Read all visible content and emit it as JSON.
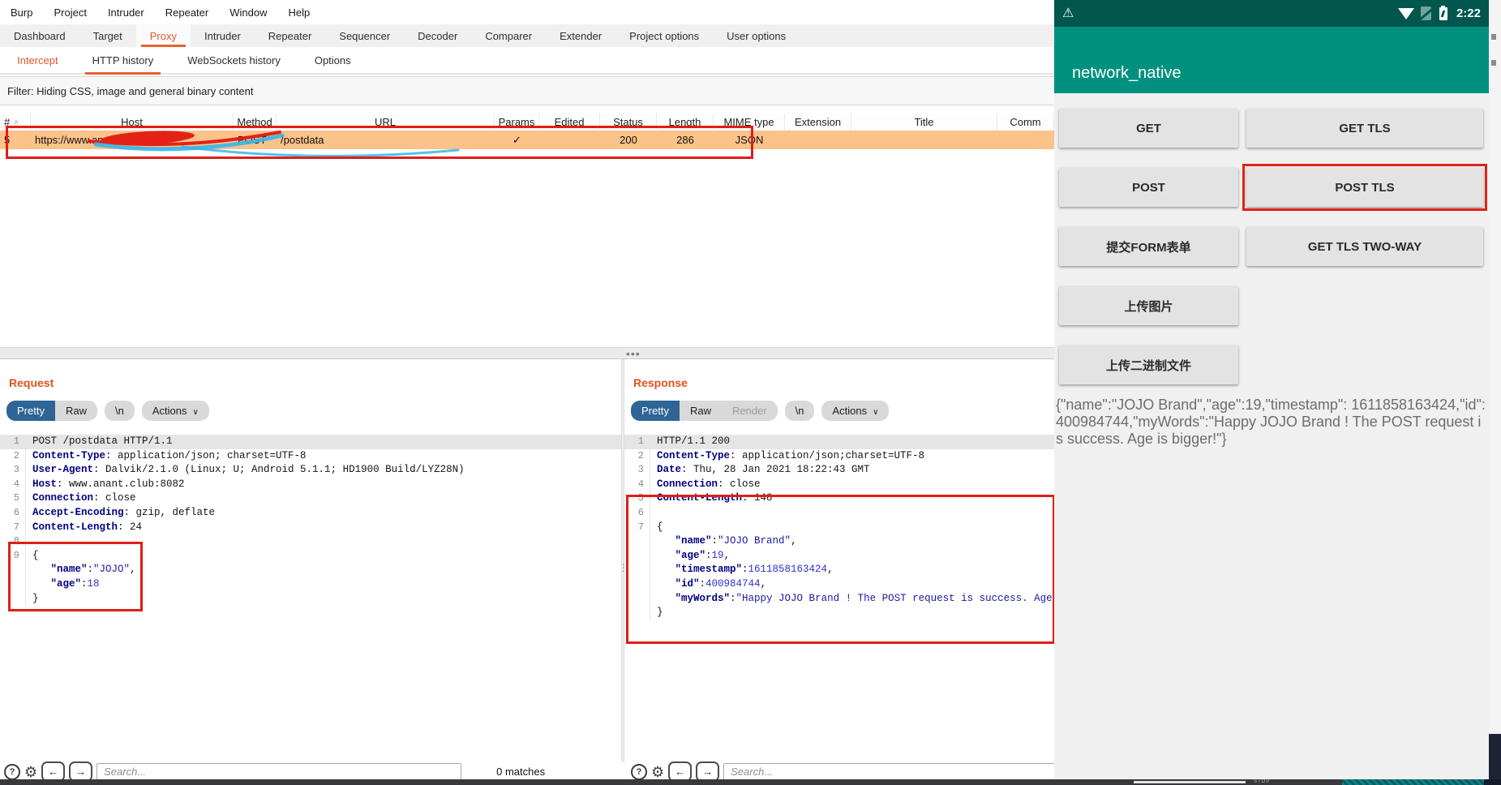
{
  "colors": {
    "accent_orange": "#e05a24",
    "selected_tab_blue": "#2e6496",
    "annotation_red": "#df1f16",
    "row_highlight_orange": "#fbc28a",
    "android_teal": "#00917e",
    "android_teal_dark": "#01564d"
  },
  "burp": {
    "menu": [
      "Burp",
      "Project",
      "Intruder",
      "Repeater",
      "Window",
      "Help"
    ],
    "main_tabs": {
      "items": [
        "Dashboard",
        "Target",
        "Proxy",
        "Intruder",
        "Repeater",
        "Sequencer",
        "Decoder",
        "Comparer",
        "Extender",
        "Project options",
        "User options"
      ],
      "selected": "Proxy"
    },
    "sub_tabs": {
      "items": [
        "Intercept",
        "HTTP history",
        "WebSockets history",
        "Options"
      ],
      "selected": "HTTP history",
      "accent": "Intercept"
    },
    "filter_text": "Filter: Hiding CSS, image and general binary content",
    "history_table": {
      "columns": [
        "#",
        "Host",
        "Method",
        "URL",
        "Params",
        "Edited",
        "Status",
        "Length",
        "MIME type",
        "Extension",
        "Title",
        "Comm"
      ],
      "row": [
        "5",
        "https://www.anant.club:8082",
        "POST",
        "/postdata",
        "✓",
        "",
        "200",
        "286",
        "JSON",
        "",
        "",
        ""
      ]
    },
    "request_panel": {
      "title": "Request",
      "tabs": [
        {
          "label": "Pretty",
          "selected": true
        },
        {
          "label": "Raw"
        }
      ],
      "newline_label": "\\n",
      "actions_label": "Actions",
      "lines": [
        {
          "n": "1",
          "hl": true,
          "seg": [
            [
              "POST /postdata HTTP/1.1",
              "p"
            ]
          ]
        },
        {
          "n": "2",
          "seg": [
            [
              "Content-Type",
              "h"
            ],
            [
              ": application/json; charset=UTF-8",
              "p"
            ]
          ]
        },
        {
          "n": "3",
          "seg": [
            [
              "User-Agent",
              "h"
            ],
            [
              ": Dalvik/2.1.0 (Linux; U; Android 5.1.1; HD1900 Build/LYZ28N)",
              "p"
            ]
          ]
        },
        {
          "n": "4",
          "seg": [
            [
              "Host",
              "h"
            ],
            [
              ": www.anant.club:8082",
              "p"
            ]
          ]
        },
        {
          "n": "5",
          "seg": [
            [
              "Connection",
              "h"
            ],
            [
              ": close",
              "p"
            ]
          ]
        },
        {
          "n": "6",
          "seg": [
            [
              "Accept-Encoding",
              "h"
            ],
            [
              ": gzip, deflate",
              "p"
            ]
          ]
        },
        {
          "n": "7",
          "seg": [
            [
              "Content-Length",
              "h"
            ],
            [
              ": 24",
              "p"
            ]
          ]
        },
        {
          "n": "8",
          "seg": []
        },
        {
          "n": "9",
          "seg": [
            [
              "{",
              "p"
            ]
          ]
        },
        {
          "n": "",
          "seg": [
            [
              "   ",
              "p"
            ],
            [
              "\"name\"",
              "k"
            ],
            [
              ":",
              "p"
            ],
            [
              "\"JOJO\"",
              "s"
            ],
            [
              ",",
              "p"
            ]
          ]
        },
        {
          "n": "",
          "seg": [
            [
              "   ",
              "p"
            ],
            [
              "\"age\"",
              "k"
            ],
            [
              ":",
              "p"
            ],
            [
              "18",
              "n"
            ]
          ]
        },
        {
          "n": "",
          "seg": [
            [
              "}",
              "p"
            ]
          ]
        }
      ]
    },
    "response_panel": {
      "title": "Response",
      "tabs": [
        {
          "label": "Pretty",
          "selected": true
        },
        {
          "label": "Raw"
        },
        {
          "label": "Render",
          "disabled": true
        }
      ],
      "newline_label": "\\n",
      "actions_label": "Actions",
      "lines": [
        {
          "n": "1",
          "hl": true,
          "seg": [
            [
              "HTTP/1.1 200",
              "p"
            ]
          ]
        },
        {
          "n": "2",
          "seg": [
            [
              "Content-Type",
              "h"
            ],
            [
              ": application/json;charset=UTF-8",
              "p"
            ]
          ]
        },
        {
          "n": "3",
          "seg": [
            [
              "Date",
              "h"
            ],
            [
              ": Thu, 28 Jan 2021 18:22:43 GMT",
              "p"
            ]
          ]
        },
        {
          "n": "4",
          "seg": [
            [
              "Connection",
              "h"
            ],
            [
              ": close",
              "p"
            ]
          ]
        },
        {
          "n": "5",
          "seg": [
            [
              "Content-Length",
              "h"
            ],
            [
              ": 148",
              "p"
            ]
          ]
        },
        {
          "n": "6",
          "seg": []
        },
        {
          "n": "7",
          "seg": [
            [
              "{",
              "p"
            ]
          ]
        },
        {
          "n": "",
          "seg": [
            [
              "   ",
              "p"
            ],
            [
              "\"name\"",
              "k"
            ],
            [
              ":",
              "p"
            ],
            [
              "\"JOJO Brand\"",
              "s"
            ],
            [
              ",",
              "p"
            ]
          ]
        },
        {
          "n": "",
          "seg": [
            [
              "   ",
              "p"
            ],
            [
              "\"age\"",
              "k"
            ],
            [
              ":",
              "p"
            ],
            [
              "19",
              "n"
            ],
            [
              ",",
              "p"
            ]
          ]
        },
        {
          "n": "",
          "seg": [
            [
              "   ",
              "p"
            ],
            [
              "\"timestamp\"",
              "k"
            ],
            [
              ":",
              "p"
            ],
            [
              "1611858163424",
              "n"
            ],
            [
              ",",
              "p"
            ]
          ]
        },
        {
          "n": "",
          "seg": [
            [
              "   ",
              "p"
            ],
            [
              "\"id\"",
              "k"
            ],
            [
              ":",
              "p"
            ],
            [
              "400984744",
              "n"
            ],
            [
              ",",
              "p"
            ]
          ]
        },
        {
          "n": "",
          "seg": [
            [
              "   ",
              "p"
            ],
            [
              "\"myWords\"",
              "k"
            ],
            [
              ":",
              "p"
            ],
            [
              "\"Happy JOJO Brand ! The POST request is success. Age is bigger!\"",
              "s"
            ]
          ]
        },
        {
          "n": "",
          "seg": [
            [
              "}",
              "p"
            ]
          ]
        }
      ]
    },
    "search": {
      "placeholder": "Search...",
      "matches_label": "0 matches"
    }
  },
  "android": {
    "status_bar": {
      "time": "2:22",
      "icons": [
        "warning-icon",
        "wifi-icon",
        "no-sim-icon",
        "battery-charging-icon"
      ]
    },
    "app_bar": {
      "title": "network_native"
    },
    "button_rows": [
      [
        "GET",
        "GET TLS"
      ],
      [
        "POST",
        "POST TLS"
      ],
      [
        "提交FORM表单",
        "GET TLS TWO-WAY"
      ],
      [
        "上传图片",
        null
      ],
      [
        "上传二进制文件",
        null
      ]
    ],
    "highlighted_button": "POST TLS",
    "result_text": "{\"name\":\"JOJO Brand\",\"age\":19,\"timestamp\": 1611858163424,\"id\":400984744,\"myWords\":\"Happy JOJO Brand ! The POST request is success. Age is bigger!\"}"
  },
  "taskbar": {
    "stop_label": "STOP"
  }
}
